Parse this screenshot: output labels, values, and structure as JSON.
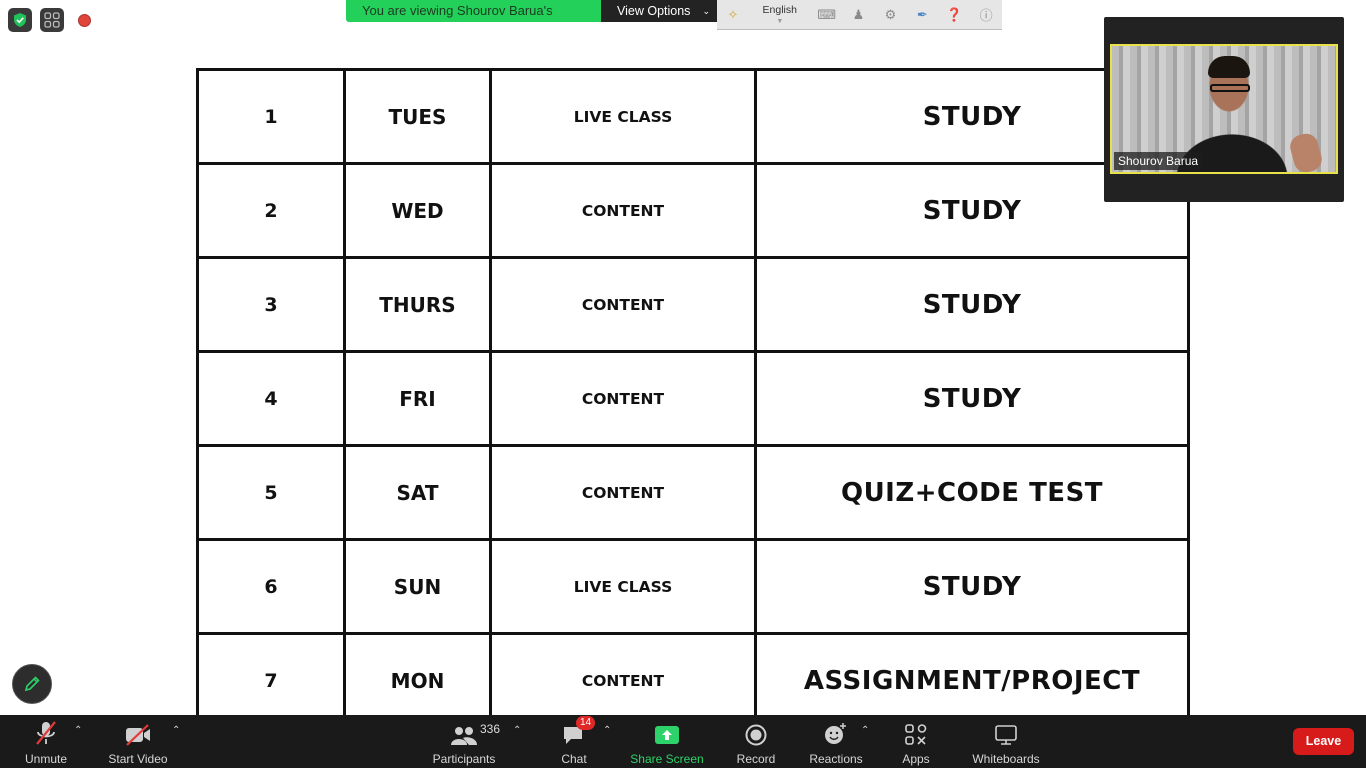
{
  "banner": {
    "viewing_text": "You are viewing Shourov Barua's screen",
    "view_options_label": "View Options"
  },
  "translation_bar": {
    "language": "English"
  },
  "schedule": {
    "rows": [
      {
        "day": "1",
        "weekday": "TUES",
        "type": "LIVE CLASS",
        "activity": "STUDY"
      },
      {
        "day": "2",
        "weekday": "WED",
        "type": "CONTENT",
        "activity": "STUDY"
      },
      {
        "day": "3",
        "weekday": "THURS",
        "type": "CONTENT",
        "activity": "STUDY"
      },
      {
        "day": "4",
        "weekday": "FRI",
        "type": "CONTENT",
        "activity": "STUDY"
      },
      {
        "day": "5",
        "weekday": "SAT",
        "type": "CONTENT",
        "activity": "QUIZ+CODE TEST"
      },
      {
        "day": "6",
        "weekday": "SUN",
        "type": "LIVE CLASS",
        "activity": "STUDY"
      },
      {
        "day": "7",
        "weekday": "MON",
        "type": "CONTENT",
        "activity": "ASSIGNMENT/PROJECT"
      }
    ]
  },
  "video": {
    "participant_name": "Shourov Barua"
  },
  "toolbar": {
    "unmute_label": "Unmute",
    "start_video_label": "Start Video",
    "participants_label": "Participants",
    "participants_count": "336",
    "chat_label": "Chat",
    "chat_badge": "14",
    "share_screen_label": "Share Screen",
    "record_label": "Record",
    "reactions_label": "Reactions",
    "apps_label": "Apps",
    "whiteboards_label": "Whiteboards",
    "leave_label": "Leave"
  },
  "colors": {
    "banner_green": "#23d059",
    "share_green": "#2ed26a",
    "leave_red": "#d71a1a",
    "speaker_border": "#e8e24a"
  }
}
